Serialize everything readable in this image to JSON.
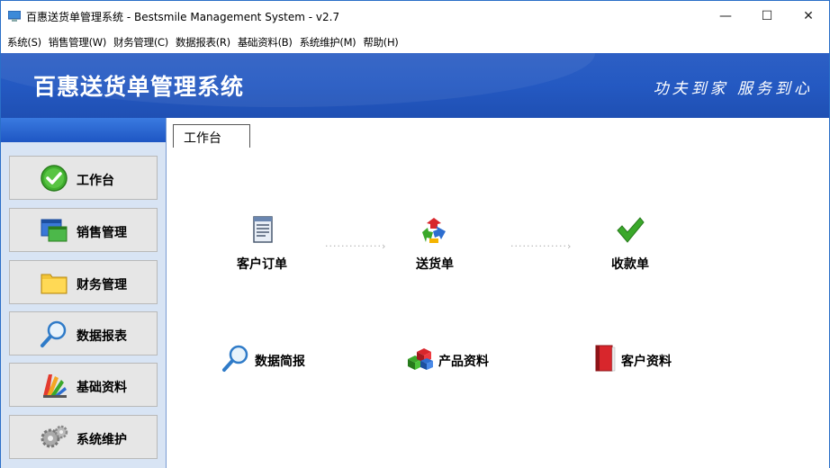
{
  "window": {
    "title": "百惠送货单管理系统 - Bestsmile Management System - v2.7",
    "minimize": "—",
    "maximize": "☐",
    "close": "✕"
  },
  "menu": [
    "系统(S)",
    "销售管理(W)",
    "财务管理(C)",
    "数据报表(R)",
    "基础资料(B)",
    "系统维护(M)",
    "帮助(H)"
  ],
  "banner": {
    "brand": "百惠送货单管理系统",
    "slogan": "功夫到家 服务到心"
  },
  "nav": [
    {
      "label": "工作台",
      "icon": "check-circle-icon"
    },
    {
      "label": "销售管理",
      "icon": "windows-icon"
    },
    {
      "label": "财务管理",
      "icon": "folder-icon"
    },
    {
      "label": "数据报表",
      "icon": "magnifier-icon"
    },
    {
      "label": "基础资料",
      "icon": "palette-icon"
    },
    {
      "label": "系统维护",
      "icon": "gears-icon"
    }
  ],
  "tab": {
    "label": "工作台"
  },
  "workflow": [
    {
      "label": "客户订单",
      "icon": "document-icon"
    },
    {
      "label": "送货单",
      "icon": "recycle-arrows-icon"
    },
    {
      "label": "收款单",
      "icon": "checkmark-icon"
    }
  ],
  "shortcuts": [
    {
      "label": "数据简报",
      "icon": "magnifier-icon"
    },
    {
      "label": "产品资料",
      "icon": "cubes-icon"
    },
    {
      "label": "客户资料",
      "icon": "red-book-icon"
    }
  ],
  "flow_connector": "··············›",
  "colors": {
    "banner": "#2459c2",
    "panel": "#d8e4f4",
    "accent_green": "#3aa82a",
    "accent_red": "#d8262c"
  }
}
